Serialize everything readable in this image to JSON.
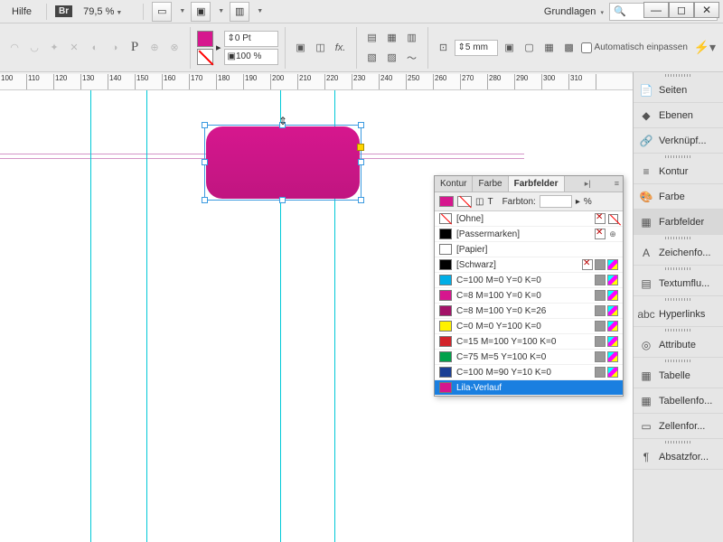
{
  "topbar": {
    "help": "Hilfe",
    "bridge": "Br",
    "zoom": "79,5 %",
    "workspace": "Grundlagen",
    "search_placeholder": ""
  },
  "ctrl": {
    "stroke_weight": "0 Pt",
    "opacity": "100 %",
    "inset": "5 mm",
    "autofit": "Automatisch einpassen",
    "pchar": "P"
  },
  "ruler": [
    "100",
    "110",
    "120",
    "130",
    "140",
    "150",
    "160",
    "170",
    "180",
    "190",
    "200",
    "210",
    "220",
    "230",
    "240",
    "250",
    "260",
    "270",
    "280",
    "290",
    "300",
    "310"
  ],
  "right_panel": [
    {
      "icon": "📄",
      "label": "Seiten"
    },
    {
      "icon": "◆",
      "label": "Ebenen"
    },
    {
      "icon": "🔗",
      "label": "Verknüpf..."
    },
    {
      "icon": "≡",
      "label": "Kontur"
    },
    {
      "icon": "🎨",
      "label": "Farbe"
    },
    {
      "icon": "▦",
      "label": "Farbfelder",
      "sel": true
    },
    {
      "icon": "A",
      "label": "Zeichenfo..."
    },
    {
      "icon": "▤",
      "label": "Textumflu..."
    },
    {
      "icon": "abc",
      "label": "Hyperlinks"
    },
    {
      "icon": "◎",
      "label": "Attribute"
    },
    {
      "icon": "▦",
      "label": "Tabelle"
    },
    {
      "icon": "▦",
      "label": "Tabellenfo..."
    },
    {
      "icon": "▭",
      "label": "Zellenfor..."
    },
    {
      "icon": "¶",
      "label": "Absatzfor..."
    }
  ],
  "swatch_panel": {
    "tabs": [
      "Kontur",
      "Farbe",
      "Farbfelder"
    ],
    "active_tab": 2,
    "t_label": "T",
    "tint_label": "Farbton:",
    "tint_unit": "%",
    "expand": "▸|",
    "menu": "≡",
    "rows": [
      {
        "color": "none",
        "name": "[Ohne]",
        "ricons": [
          "x",
          "none"
        ]
      },
      {
        "color": "#000",
        "name": "[Passermarken]",
        "ricons": [
          "x",
          "reg"
        ]
      },
      {
        "color": "#fff",
        "name": "[Papier]",
        "ricons": []
      },
      {
        "color": "#000",
        "name": "[Schwarz]",
        "ricons": [
          "x",
          "g",
          "c"
        ]
      },
      {
        "color": "#00aee6",
        "name": "C=100 M=0 Y=0 K=0",
        "ricons": [
          "g",
          "c"
        ]
      },
      {
        "color": "#d6178e",
        "name": "C=8 M=100 Y=0 K=0",
        "ricons": [
          "g",
          "c"
        ]
      },
      {
        "color": "#a31268",
        "name": "C=8 M=100 Y=0 K=26",
        "ricons": [
          "g",
          "c"
        ]
      },
      {
        "color": "#fff200",
        "name": "C=0 M=0 Y=100 K=0",
        "ricons": [
          "g",
          "c"
        ]
      },
      {
        "color": "#d2232a",
        "name": "C=15 M=100 Y=100 K=0",
        "ricons": [
          "g",
          "c"
        ]
      },
      {
        "color": "#00a14b",
        "name": "C=75 M=5 Y=100 K=0",
        "ricons": [
          "g",
          "c"
        ]
      },
      {
        "color": "#1b3f94",
        "name": "C=100 M=90 Y=10 K=0",
        "ricons": [
          "g",
          "c"
        ]
      },
      {
        "color": "#d6178e",
        "name": "Lila-Verlauf",
        "sel": true,
        "ricons": []
      }
    ]
  }
}
